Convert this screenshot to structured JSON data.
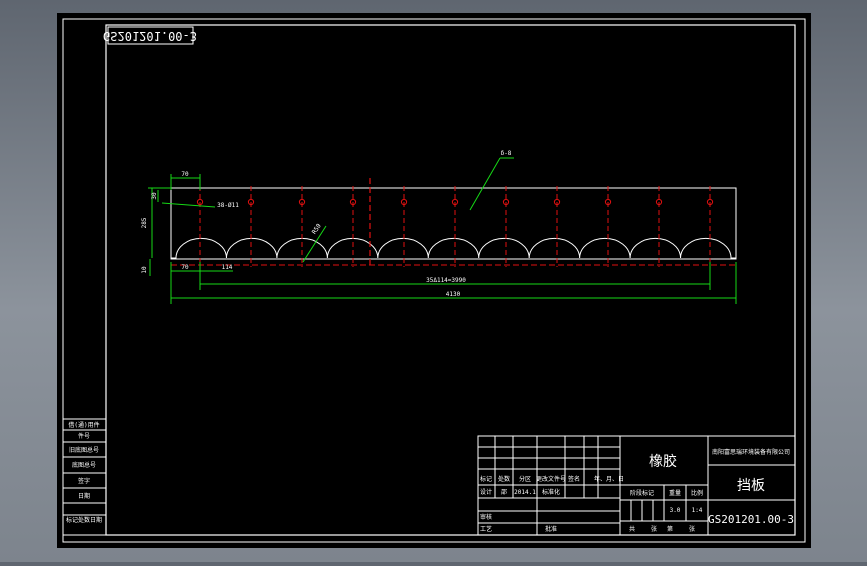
{
  "drawing": {
    "mirrored_number": "GS201201.00-3",
    "material_note": "δ-8",
    "dims": {
      "edge_top": "70",
      "edge_bottom": "70",
      "hole_label": "38-Ø11",
      "offset_left": "30",
      "height_total": "285",
      "base_height": "10",
      "radius": "R50",
      "pitch": "114",
      "pitch_chain": "35Δ114=3990",
      "overall_length": "4130"
    }
  },
  "left_stamp": {
    "rows": [
      "借(通)用件",
      "件号",
      "旧底图总号",
      "底图总号",
      "签字",
      "日期",
      "标记处数日期"
    ]
  },
  "title_block": {
    "material": "橡胶",
    "company": "南阳富思瑞环境装备有限公司",
    "part_name": "挡板",
    "drawing_number": "GS201201.00-3",
    "rev_headers": [
      "标记",
      "处数",
      "分区",
      "更改文件号",
      "签名",
      "年、月、日"
    ],
    "design_label": "设计",
    "designer": "邵",
    "design_date": "2014.1",
    "standardize_label": "标准化",
    "review_label": "审核",
    "process_label": "工艺",
    "approve_label": "批准",
    "stage_label": "阶段标记",
    "weight_label": "重量",
    "scale_label": "比例",
    "weight": "3.0",
    "scale": "1:4",
    "sheet_total_label": "共",
    "sheets_label": "张",
    "sheet_label": "第",
    "sheet_suffix": "张"
  }
}
